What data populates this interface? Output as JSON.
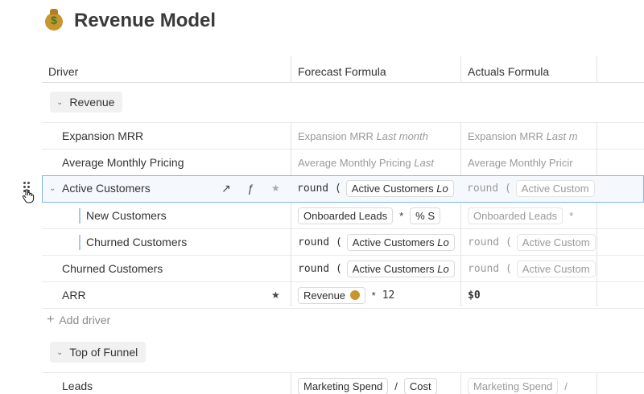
{
  "page": {
    "title": "Revenue Model",
    "title_icon": "money-bag-icon"
  },
  "columns": {
    "driver": "Driver",
    "forecast": "Forecast Formula",
    "actuals": "Actuals Formula"
  },
  "groups": {
    "revenue": "Revenue",
    "top_of_funnel": "Top of Funnel"
  },
  "rows": {
    "expansion_mrr": {
      "label": "Expansion MRR",
      "forecast_ref": "Expansion MRR",
      "forecast_suffix": "Last month",
      "actuals_ref": "Expansion MRR",
      "actuals_suffix": "Last m"
    },
    "avg_pricing": {
      "label": "Average Monthly Pricing",
      "forecast_ref": "Average Monthly Pricing",
      "forecast_suffix": "Last",
      "actuals_ref": "Average Monthly Pricir"
    },
    "active_customers": {
      "label": "Active Customers",
      "forecast_fn": "round (",
      "forecast_chip": "Active Customers",
      "forecast_chip_suffix": "Lo",
      "actuals_fn": "round (",
      "actuals_chip": "Active Custom"
    },
    "new_customers": {
      "label": "New Customers",
      "forecast_chip": "Onboarded Leads",
      "forecast_op": "*",
      "forecast_chip2": "% S",
      "actuals_chip": "Onboarded Leads",
      "actuals_op": "*"
    },
    "churned_child": {
      "label": "Churned Customers",
      "forecast_fn": "round (",
      "forecast_chip": "Active Customers",
      "forecast_chip_suffix": "Lo",
      "actuals_fn": "round (",
      "actuals_chip": "Active Custom"
    },
    "churned_top": {
      "label": "Churned Customers",
      "forecast_fn": "round (",
      "forecast_chip": "Active Customers",
      "forecast_chip_suffix": "Lo",
      "actuals_fn": "round (",
      "actuals_chip": "Active Custom"
    },
    "arr": {
      "label": "ARR",
      "forecast_chip": "Revenue",
      "forecast_op": "*",
      "forecast_num": "12",
      "actuals_value": "$0"
    },
    "leads": {
      "label": "Leads",
      "forecast_chip": "Marketing Spend",
      "forecast_op": "/",
      "forecast_chip2": "Cost",
      "actuals_chip": "Marketing Spend",
      "actuals_op": "/"
    }
  },
  "add_driver": "Add driver"
}
